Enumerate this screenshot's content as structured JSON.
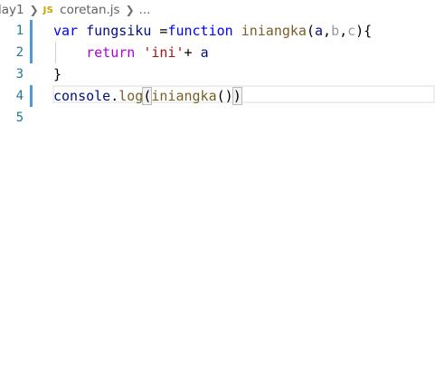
{
  "breadcrumb": {
    "folder": "lay1",
    "file_icon": "JS",
    "file": "coretan.js",
    "more": "..."
  },
  "colors": {
    "keyword": "#0000ff",
    "control_keyword": "#af00db",
    "function_name": "#795e26",
    "variable": "#001080",
    "unused_param": "#9a9a9a",
    "string": "#a31515",
    "line_number": "#237893",
    "modified_bar": "#4f9ad6"
  },
  "editor": {
    "lines": [
      {
        "number": "1",
        "tokens": [
          {
            "text": "var",
            "kind": "keyword"
          },
          {
            "text": " ",
            "kind": "plain"
          },
          {
            "text": "fungsiku",
            "kind": "variable"
          },
          {
            "text": " =",
            "kind": "plain"
          },
          {
            "text": "function",
            "kind": "keyword"
          },
          {
            "text": " ",
            "kind": "plain"
          },
          {
            "text": "iniangka",
            "kind": "function"
          },
          {
            "text": "(",
            "kind": "plain"
          },
          {
            "text": "a",
            "kind": "variable"
          },
          {
            "text": ",",
            "kind": "plain"
          },
          {
            "text": "b",
            "kind": "unused"
          },
          {
            "text": ",",
            "kind": "plain"
          },
          {
            "text": "c",
            "kind": "unused"
          },
          {
            "text": "){",
            "kind": "plain"
          }
        ]
      },
      {
        "number": "2",
        "tokens": [
          {
            "text": "    ",
            "kind": "plain"
          },
          {
            "text": "return",
            "kind": "control"
          },
          {
            "text": " ",
            "kind": "plain"
          },
          {
            "text": "'ini'",
            "kind": "string"
          },
          {
            "text": "+ ",
            "kind": "plain"
          },
          {
            "text": "a",
            "kind": "variable"
          }
        ]
      },
      {
        "number": "3",
        "tokens": [
          {
            "text": "}",
            "kind": "plain"
          }
        ]
      },
      {
        "number": "4",
        "tokens": [
          {
            "text": "console",
            "kind": "variable"
          },
          {
            "text": ".",
            "kind": "plain"
          },
          {
            "text": "log",
            "kind": "function"
          },
          {
            "text": "(",
            "kind": "bracket"
          },
          {
            "text": "iniangka",
            "kind": "function"
          },
          {
            "text": "()",
            "kind": "plain"
          },
          {
            "text": ")",
            "kind": "bracket"
          }
        ]
      },
      {
        "number": "5",
        "tokens": []
      }
    ]
  }
}
